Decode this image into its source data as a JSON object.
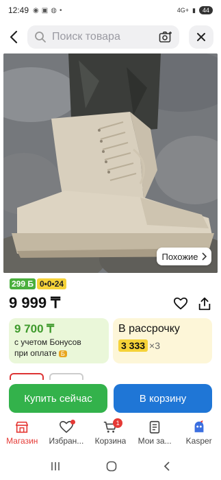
{
  "status": {
    "time": "12:49",
    "network": "4G+",
    "battery": "44"
  },
  "search": {
    "placeholder": "Поиск товара"
  },
  "product": {
    "similar_label": "Похожие",
    "bonus_badge": "299 Б",
    "installment_badge": "0•0•24",
    "price": "9 999 ₸"
  },
  "bonus_card": {
    "amount": "9 700 ₸",
    "line1": "с учетом Бонусов",
    "line2": "при оплате"
  },
  "installment_card": {
    "label": "В рассрочку",
    "monthly": "3 333",
    "multiplier": "×3"
  },
  "actions": {
    "buy_now": "Купить сейчас",
    "add_to_cart": "В корзину"
  },
  "tabbar": {
    "items": [
      {
        "label": "Магазин"
      },
      {
        "label": "Избран..."
      },
      {
        "label": "Корзина"
      },
      {
        "label": "Мои за..."
      },
      {
        "label": "Kasper"
      }
    ],
    "cart_count": "1"
  },
  "colors": {
    "accent_red": "#e53935",
    "buy_green": "#33b24b",
    "cart_blue": "#1f76d6",
    "bonus_green": "#4aaf3d",
    "installment_yellow": "#f5d238"
  }
}
